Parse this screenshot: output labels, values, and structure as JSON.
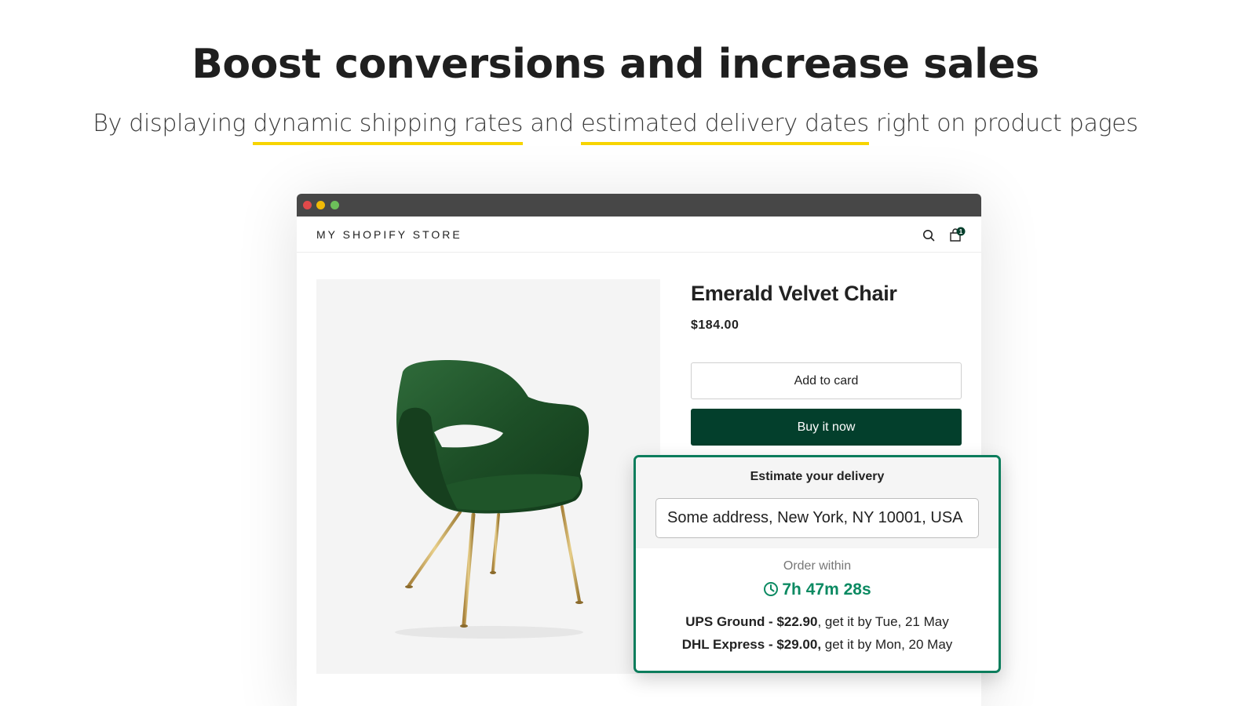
{
  "hero": {
    "headline": "Boost conversions and increase sales",
    "subline_prefix": "By displaying ",
    "subline_highlight_1": "dynamic shipping rates",
    "subline_middle": " and ",
    "subline_highlight_2": "estimated delivery dates",
    "subline_suffix": " right on product pages",
    "highlight_color": "#f7d400"
  },
  "browser": {
    "window_controls": [
      "close",
      "minimize",
      "maximize"
    ]
  },
  "store": {
    "name": "MY SHOPIFY STORE",
    "icons": [
      "search-icon",
      "cart-icon"
    ],
    "cart_count": "1"
  },
  "product": {
    "image": "emerald-velvet-chair-photo",
    "title": "Emerald Velvet Chair",
    "price": "$184.00",
    "add_button": "Add to card",
    "buy_button": "Buy it now",
    "buy_button_color": "#033f2c"
  },
  "estimate": {
    "title": "Estimate your delivery",
    "address_value": "Some address, New York, NY 10001, USA",
    "order_within_label": "Order within",
    "countdown": "7h 47m 28s",
    "accent_color": "#0c7d5c",
    "rates": [
      {
        "carrier_price": "UPS Ground - $22.90",
        "sep": ",",
        "delivery": " get it by Tue, 21 May"
      },
      {
        "carrier_price": "DHL Express - $29.00,",
        "sep": "",
        "delivery": " get it by Mon, 20 May"
      }
    ]
  }
}
